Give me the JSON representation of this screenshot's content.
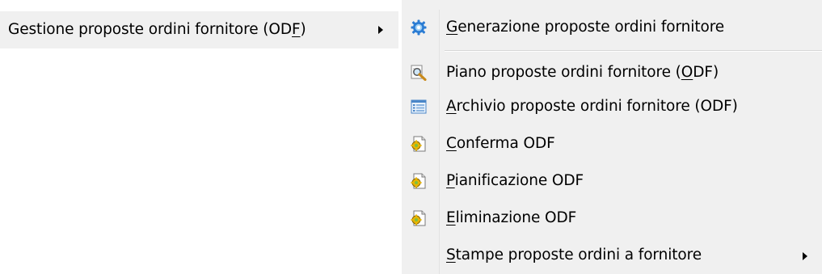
{
  "parent": {
    "label_pre": "Gestione proposte ordini fornitore (OD",
    "label_key": "F",
    "label_post": ")"
  },
  "submenu": {
    "items": [
      {
        "pre": "",
        "key": "G",
        "post": "enerazione proposte ordini fornitore",
        "icon": "gear-icon"
      },
      {
        "pre": "Piano proposte ordini fornitore (",
        "key": "O",
        "post": "DF)",
        "icon": "magnifier-icon"
      },
      {
        "pre": "",
        "key": "A",
        "post": "rchivio proposte ordini fornitore (ODF)",
        "icon": "list-icon"
      },
      {
        "pre": "",
        "key": "C",
        "post": "onferma ODF",
        "icon": "document-gear-icon"
      },
      {
        "pre": "",
        "key": "P",
        "post": "ianificazione ODF",
        "icon": "document-gear-icon"
      },
      {
        "pre": "",
        "key": "E",
        "post": "liminazione ODF",
        "icon": "document-gear-icon"
      },
      {
        "pre": "",
        "key": "S",
        "post": "tampe proposte ordini a fornitore",
        "icon": "none"
      }
    ]
  },
  "colors": {
    "menu_bg": "#f0f0f0",
    "hover_bg": "#f0f0f0",
    "separator": "#d7d7d7",
    "gear_blue": "#2b7cd3",
    "gear_yellow": "#e8b400"
  }
}
